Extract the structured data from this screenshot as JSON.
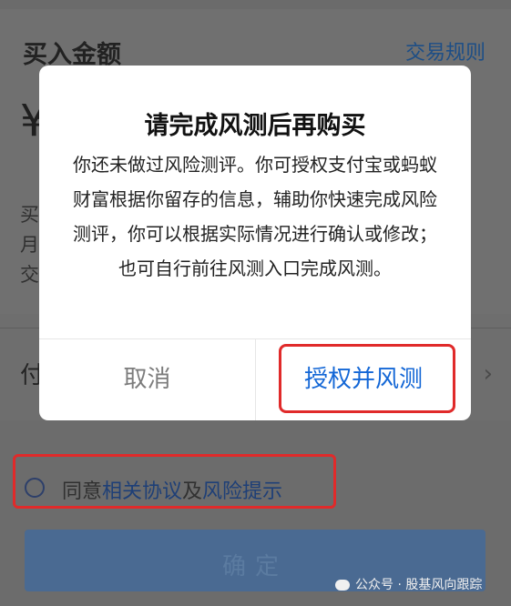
{
  "page": {
    "title": "买入金额",
    "rules_link": "交易规则",
    "currency_symbol": "¥",
    "info_lines": [
      "买",
      "月",
      "交"
    ],
    "payment_label": "付",
    "agreement_prefix": "同意",
    "agreement_link_1": "相关协议",
    "agreement_mid": "及",
    "agreement_link_2": "风险提示",
    "confirm_label": "确定"
  },
  "dialog": {
    "title": "请完成风测后再购买",
    "message": "你还未做过风险测评。你可授权支付宝或蚂蚁财富根据你留存的信息，辅助你快速完成风险测评，你可以根据实际情况进行确认或修改；也可自行前往风测入口完成风测。",
    "cancel_label": "取消",
    "confirm_label": "授权并风测"
  },
  "watermark": {
    "text": "公众号 · 股基风向跟踪"
  },
  "colors": {
    "accent": "#1467d6",
    "highlight": "#e02a2a",
    "overlay": "#6e6e6e"
  }
}
